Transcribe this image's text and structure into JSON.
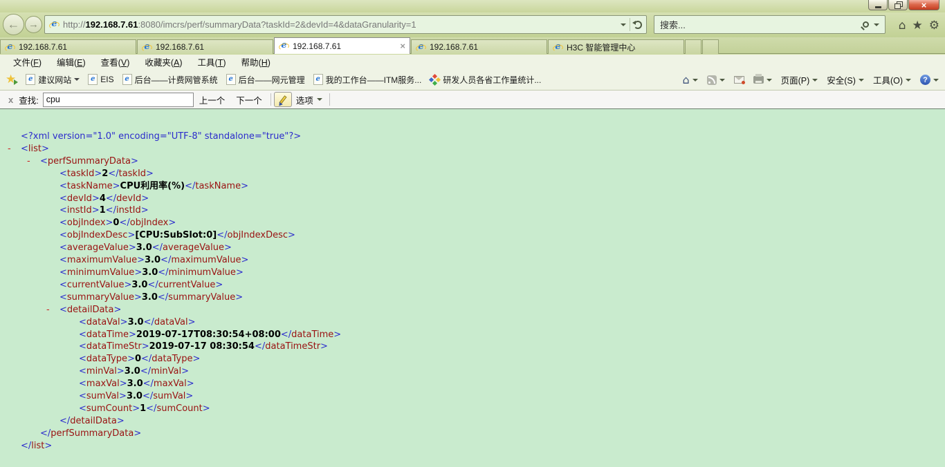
{
  "nav": {
    "url_scheme": "http://",
    "url_host": "192.168.7.61",
    "url_path": ":8080/imcrs/perf/summaryData?taskId=2&devId=4&dataGranularity=1",
    "search_placeholder": "搜索..."
  },
  "tabs": [
    {
      "label": "192.168.7.61",
      "active": false
    },
    {
      "label": "192.168.7.61",
      "active": false
    },
    {
      "label": "192.168.7.61",
      "active": true
    },
    {
      "label": "192.168.7.61",
      "active": false
    },
    {
      "label": "H3C 智能管理中心",
      "active": false
    }
  ],
  "menu": [
    {
      "text": "文件",
      "key": "F"
    },
    {
      "text": "编辑",
      "key": "E"
    },
    {
      "text": "查看",
      "key": "V"
    },
    {
      "text": "收藏夹",
      "key": "A"
    },
    {
      "text": "工具",
      "key": "T"
    },
    {
      "text": "帮助",
      "key": "H"
    }
  ],
  "favorites": [
    {
      "label": "建议网站",
      "icon": "ie",
      "dropdown": true
    },
    {
      "label": "EIS",
      "icon": "ie"
    },
    {
      "label": "后台——计费网管系统",
      "icon": "ie"
    },
    {
      "label": "后台——网元管理",
      "icon": "ie"
    },
    {
      "label": "我的工作台——ITM服务...",
      "icon": "ie"
    },
    {
      "label": "研发人员各省工作量统计...",
      "icon": "diamond"
    }
  ],
  "command_bar": {
    "page": "页面(P)",
    "security": "安全(S)",
    "tools": "工具(O)"
  },
  "find_bar": {
    "label": "查找:",
    "value": "cpu",
    "prev": "上一个",
    "next": "下一个",
    "options": "选项"
  },
  "colors": {
    "content_background": "#c9ebce",
    "chrome_green": "#c9d69c",
    "xml_markup_blue": "#2b2bcc",
    "xml_tag_maroon": "#991111",
    "close_button_red": "#c33c20"
  },
  "xml": {
    "lines": [
      {
        "t": "decl",
        "level": 0,
        "text": "<?xml version=\"1.0\" encoding=\"UTF-8\" standalone=\"true\"?>"
      },
      {
        "t": "open",
        "level": 0,
        "tag": "list"
      },
      {
        "t": "open",
        "level": 1,
        "tag": "perfSummaryData"
      },
      {
        "t": "leaf",
        "level": 2,
        "tag": "taskId",
        "value": "2"
      },
      {
        "t": "leaf",
        "level": 2,
        "tag": "taskName",
        "value": "CPU利用率(%)"
      },
      {
        "t": "leaf",
        "level": 2,
        "tag": "devId",
        "value": "4"
      },
      {
        "t": "leaf",
        "level": 2,
        "tag": "instId",
        "value": "1"
      },
      {
        "t": "leaf",
        "level": 2,
        "tag": "objIndex",
        "value": "0"
      },
      {
        "t": "leaf",
        "level": 2,
        "tag": "objIndexDesc",
        "value": "[CPU:SubSlot:0]"
      },
      {
        "t": "leaf",
        "level": 2,
        "tag": "averageValue",
        "value": "3.0"
      },
      {
        "t": "leaf",
        "level": 2,
        "tag": "maximumValue",
        "value": "3.0"
      },
      {
        "t": "leaf",
        "level": 2,
        "tag": "minimumValue",
        "value": "3.0"
      },
      {
        "t": "leaf",
        "level": 2,
        "tag": "currentValue",
        "value": "3.0"
      },
      {
        "t": "leaf",
        "level": 2,
        "tag": "summaryValue",
        "value": "3.0"
      },
      {
        "t": "open",
        "level": 2,
        "tag": "detailData"
      },
      {
        "t": "leaf",
        "level": 3,
        "tag": "dataVal",
        "value": "3.0"
      },
      {
        "t": "leaf",
        "level": 3,
        "tag": "dataTime",
        "value": "2019-07-17T08:30:54+08:00"
      },
      {
        "t": "leaf",
        "level": 3,
        "tag": "dataTimeStr",
        "value": "2019-07-17 08:30:54"
      },
      {
        "t": "leaf",
        "level": 3,
        "tag": "dataType",
        "value": "0"
      },
      {
        "t": "leaf",
        "level": 3,
        "tag": "minVal",
        "value": "3.0"
      },
      {
        "t": "leaf",
        "level": 3,
        "tag": "maxVal",
        "value": "3.0"
      },
      {
        "t": "leaf",
        "level": 3,
        "tag": "sumVal",
        "value": "3.0"
      },
      {
        "t": "leaf",
        "level": 3,
        "tag": "sumCount",
        "value": "1"
      },
      {
        "t": "close",
        "level": 2,
        "tag": "detailData"
      },
      {
        "t": "close",
        "level": 1,
        "tag": "perfSummaryData"
      },
      {
        "t": "close",
        "level": 0,
        "tag": "list"
      }
    ]
  }
}
